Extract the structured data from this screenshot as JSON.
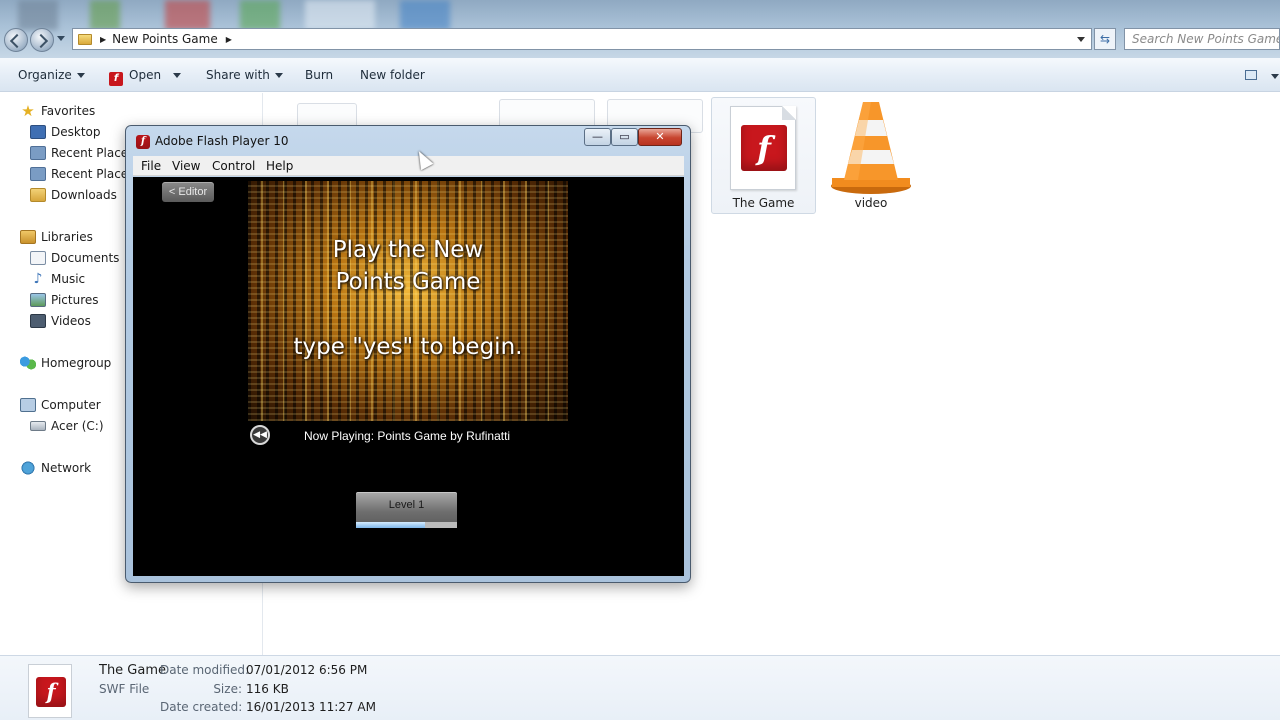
{
  "explorer": {
    "address": {
      "crumb": "New Points Game"
    },
    "search": {
      "placeholder": "Search New Points Game"
    },
    "command_bar": {
      "organize": "Organize",
      "open": "Open",
      "share_with": "Share with",
      "burn": "Burn",
      "new_folder": "New folder"
    },
    "nav": {
      "favorites": "Favorites",
      "desktop": "Desktop",
      "recent_places_1": "Recent Places",
      "recent_places_2": "Recent Places",
      "downloads": "Downloads",
      "libraries": "Libraries",
      "documents": "Documents",
      "music": "Music",
      "pictures": "Pictures",
      "videos": "Videos",
      "homegroup": "Homegroup",
      "computer": "Computer",
      "drive": "Acer (C:)",
      "network": "Network"
    },
    "files": [
      {
        "label": "The Game",
        "icon": "flash-swf-icon",
        "selected": true
      },
      {
        "label": "video",
        "icon": "vlc-cone-icon",
        "selected": false
      }
    ],
    "details": {
      "name": "The Game",
      "type": "SWF File",
      "modified_label": "Date modified:",
      "modified_value": "07/01/2012 6:56 PM",
      "size_label": "Size:",
      "size_value": "116 KB",
      "created_label": "Date created:",
      "created_value": "16/01/2013 11:27 AM"
    }
  },
  "flash": {
    "title": "Adobe Flash Player 10",
    "menu": {
      "file": "File",
      "view": "View",
      "control": "Control",
      "help": "Help"
    },
    "editor_button": "< Editor",
    "video_line1": "Play the New",
    "video_line2": "Points Game",
    "video_line3": "type \"yes\" to begin.",
    "now_playing": "Now Playing: Points Game by Rufinatti",
    "level_label": "Level 1",
    "level_progress": 0.68
  },
  "colors": {
    "flash_red": "#c8171d",
    "vlc_orange": "#f28c1e",
    "stage_bg": "#000000"
  }
}
